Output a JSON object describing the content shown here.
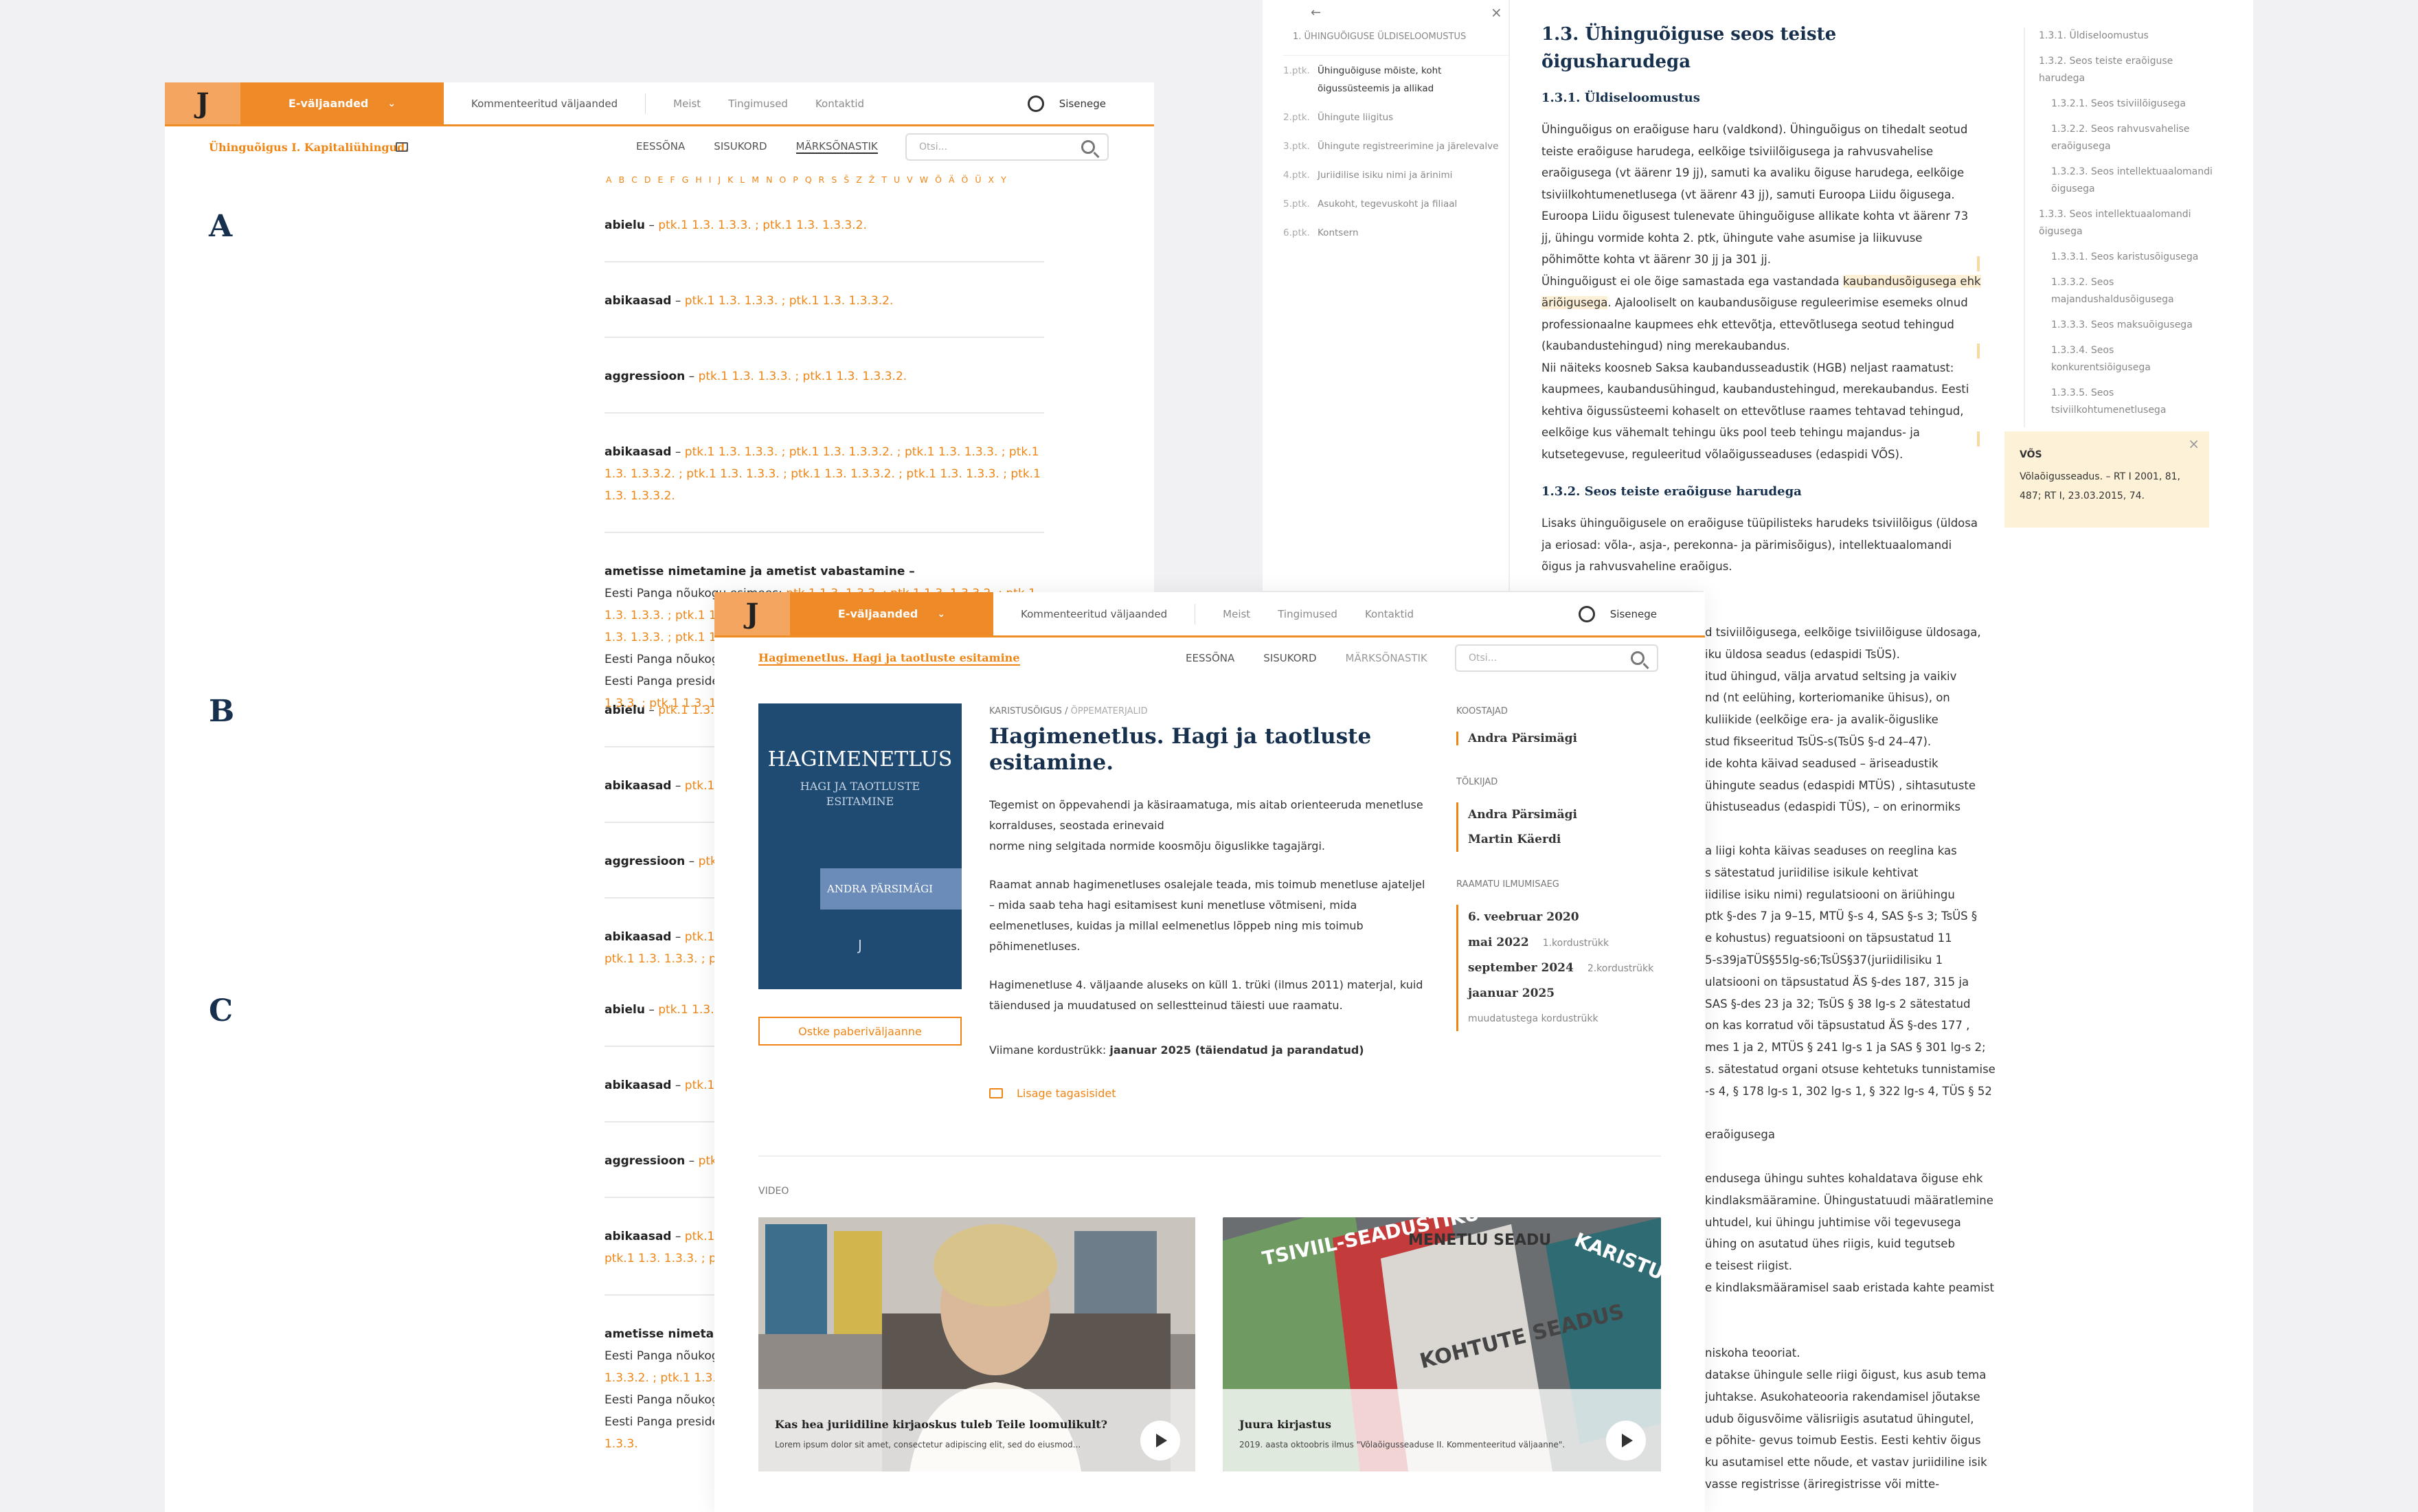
{
  "common": {
    "e_valjaanded": "E-väljaanded",
    "kommenteeritud": "Kommenteeritud väljaanded",
    "meist": "Meist",
    "tingimused": "Tingimused",
    "kontaktid": "Kontaktid",
    "sisenege": "Sisenege",
    "eessona": "EESSÕNA",
    "sisukord": "SISUKORD",
    "marksonastik": "MÄRKSÕNASTIK",
    "search_placeholder": "Otsi...",
    "logo": "J"
  },
  "index_page": {
    "book_title": "Ühinguõigus I. Kapitaliühingud.",
    "alphabet": [
      "A",
      "B",
      "C",
      "D",
      "E",
      "F",
      "G",
      "H",
      "I",
      "J",
      "K",
      "L",
      "M",
      "N",
      "O",
      "P",
      "Q",
      "R",
      "S",
      "Š",
      "Z",
      "Ž",
      "T",
      "U",
      "V",
      "W",
      "Õ",
      "Ä",
      "Ö",
      "Ü",
      "X",
      "Y"
    ],
    "sections": [
      {
        "letter": "A",
        "entries": [
          {
            "term": "abielu",
            "refs": "ptk.1 1.3. 1.3.3. ; ptk.1 1.3. 1.3.3.2."
          },
          {
            "term": "abikaasad",
            "refs": "ptk.1 1.3. 1.3.3. ; ptk.1 1.3. 1.3.3.2."
          },
          {
            "term": "aggressioon",
            "refs": "ptk.1 1.3. 1.3.3. ; ptk.1 1.3. 1.3.3.2."
          },
          {
            "term": "abikaasad",
            "refs": "ptk.1 1.3. 1.3.3. ; ptk.1 1.3. 1.3.3.2. ; ptk.1 1.3. 1.3.3. ; ptk.1 1.3. 1.3.3.2. ; ptk.1 1.3. 1.3.3. ; ptk.1 1.3. 1.3.3.2. ; ptk.1 1.3. 1.3.3. ; ptk.1 1.3. 1.3.3.2."
          },
          {
            "term": "ametisse nimetamine ja ametist vabastamine –",
            "sub": [
              {
                "label": "Eesti Panga nõukogu esimees:",
                "refs": "ptk.1 1.3. 1.3.3. ; ptk.1 1.3. 1.3.3.2. ; ptk.1 1.3. 1.3.3. ; ptk.1 1.3. 1.3.3.2. ; ptk.1 1.3. 1.3.3. ; ptk.1 1.3. 1.3.3.2. ; ptk.1 1.3. 1.3.3. ; ptk.1 1.3. 1.3.3.2."
              },
              {
                "label": "Eesti Panga nõukogu liikmed:",
                "refs": "ptk.1 1.3. 1.3.3."
              },
              {
                "label": "Eesti Panga president:",
                "refs": "ptk.1 1.3. 1.3.3. ; ptk.1 1.3. 1.3.3.2. ; ptk.1 1.3. 1.3.3. ; ptk.1 1.3. 1.3.3.2. ; ptk.1 1.3. 1.3.3."
              }
            ]
          }
        ]
      },
      {
        "letter": "B",
        "entries": [
          {
            "term": "abielu",
            "refs": "ptk.1 1.3. 1.3.3. ; ptk.1 1.3. 1.3.3.2."
          },
          {
            "term": "abikaasad",
            "refs": "ptk.1 1.3. 1.3.3. ; ptk.1 1.3. 1.3.3.2."
          },
          {
            "term": "aggressioon",
            "refs": "ptk.1 1.3. 1.3.3. ; ptk.1 1.3. 1.3.3.2."
          },
          {
            "term": "abikaasad",
            "refs": "ptk.1 1.3. 1.3.3. ; ptk.1 1.3. 1.3.3.2. ; ptk.1 1.3. 1.3.3.2. ; ptk.1 1.3. 1.3.3. ; ptk.1 1.3. 1.3.3.2. ; ptk"
          }
        ]
      },
      {
        "letter": "C",
        "entries": [
          {
            "term": "abielu",
            "refs": "ptk.1 1.3. 1.3.3. ; ptk.1 1.3. 1.3.3.2."
          },
          {
            "term": "abikaasad",
            "refs": "ptk.1 1.3. 1.3.3. ; ptk.1 1.3. 1.3.3.2."
          },
          {
            "term": "aggressioon",
            "refs": "ptk.1 1.3. 1.3.3. ; ptk.1 1.3. 1.3.3.2."
          },
          {
            "term": "abikaasad",
            "refs": "ptk.1 1.3. 1.3.3. ; ptk.1 1.3. 1.3.3.2. ; ptk.1 1.3. 1.3.3.2. ; ptk.1 1.3. 1.3.3. ; ptk.1 1.3. 1.3.3.2. ; ptk"
          },
          {
            "term": "ametisse nimetamine ja ametist vabastamine –",
            "sub": [
              {
                "label": "Eesti Panga nõukogu esimees:",
                "refs": "ptk.1 1.3. 1.3.3. ; ptk 1.3.3. ; ptk.1 1.3. 1.3.3.2. ; ptk.1 1.3. 1.3.3. ; ptk ptk.1 1.3.3.2."
              },
              {
                "label": "Eesti Panga nõukogu liikmed:",
                "refs": "ptk.1 1.3. 1.3.3."
              },
              {
                "label": "Eesti Panga president:",
                "refs": "ptk.1 1.3. 1.3.3. ; ptk.1 1.3. 1.3.3.2. ; ptk.1 1.3. 1.3.3."
              }
            ]
          }
        ]
      }
    ]
  },
  "reader_page": {
    "chapter_title": "1. ÜHINGUÕIGUSE ÜLDISELOOMUSTUS",
    "chapters": [
      {
        "num": "1.ptk.",
        "title": "Ühinguõiguse mõiste, koht õigussüsteemis ja allikad"
      },
      {
        "num": "2.ptk.",
        "title": "Ühingute liigitus"
      },
      {
        "num": "3.ptk.",
        "title": "Ühingute registreerimine ja järelevalve"
      },
      {
        "num": "4.ptk.",
        "title": "Juriidilise isiku nimi ja ärinimi"
      },
      {
        "num": "5.ptk.",
        "title": "Asukoht, tegevuskoht ja filiaal"
      },
      {
        "num": "6.ptk.",
        "title": "Kontsern"
      }
    ],
    "heading": "1.3. Ühinguõiguse seos teiste õigusharudega",
    "sub1": "1.3.1. Üldiseloomustus",
    "p1": "Ühinguõigus on eraõiguse haru (valdkond). Ühinguõigus on tihedalt seotud teiste eraõiguse harudega, eelkõige tsiviilõigusega ja rahvusvahelise eraõigusega (vt äärenr 19 jj), samuti ka avaliku õiguse harudega, eelkõige tsiviilkohtumenetlusega (vt äärenr 43 jj), samuti Euroopa Liidu õigusega. Euroopa Liidu õigusest tulenevate ühinguõiguse allikate kohta vt äärenr 73 jj, ühingu vormide kohta 2. ptk, ühingute vahe asumise ja liikuvuse põhimõtte kohta vt äärenr 30 jj ja 301 jj.",
    "p2a": "Ühinguõigust ei ole õige samastada ega vastandada ",
    "p2hl": "kaubandusõigusega ehk äriõigusega",
    "p2b": ". Ajalooliselt on kaubandusõiguse reguleerimise esemeks olnud professionaalne kaupmees ehk ettevõtja, ettevõtlusega seotud tehingud (kaubandustehingud) ning merekaubandus.",
    "p3": "Nii näiteks koosneb Saksa kaubandusseadustik (HGB) neljast raamatust: kaupmees, kaubandusühingud, kaubandustehingud, merekaubandus. Eesti kehtiva õigussüsteemi kohaselt on ettevõtluse raames tehtavad tehingud, eelkõige kus vähemalt tehingu üks pool teeb tehingu majandus- ja kutsetegevuse, reguleeritud võlaõigusseaduses (edaspidi VÕS).",
    "sub2": "1.3.2. Seos teiste eraõiguse harudega",
    "p4": "Lisaks ühinguõigusele on eraõiguse tüüpilisteks harudeks tsiviilõigus (üldosa ja eriosad: võla-, asja-, perekonna- ja pärimisõigus), intellektuaalomandi õigus ja rahvusvaheline eraõigus.",
    "cont": [
      "d tsiviilõigusega, eelkõige tsiviilõiguse üldosaga,",
      "iku üldosa seadus (edaspidi TsÜS).",
      "itud ühingud, välja arvatud seltsing ja vaikiv",
      "nd (nt eelühing, korteriomanike ühisus), on",
      "kuliikide (eelkõige era- ja avalik-õiguslike",
      "stud fikseeritud TsÜS-s(TsÜS §-d 24–47).",
      "ide kohta käivad seadused – äriseadustik",
      "ühingute seadus (edaspidi MTÜS) , sihtasutuste",
      "ühistuseadus (edaspidi TÜS), – on erinormiks",
      "",
      "a liigi kohta käivas seaduses on reeglina kas",
      "s sätestatud juriidilise isikule kehtivat",
      "iidilise isiku nimi) regulatsiooni on äriühingu",
      "ptk §-des 7 ja 9–15, MTÜ §-s 4, SAS §-s 3; TsÜS §",
      "e kohustus) reguatsiooni on täpsustatud 11",
      "5-s39jaTÜS§55lg-s6;TsÜS§37(juriidilisiku 1",
      "ulatsiooni on täpsustatud ÄS §-des 187, 315 ja",
      "SAS §-des 23 ja 32; TsÜS § 38 lg-s 2 sätestatud",
      "on kas korratud või täpsustatud ÄS §-des 177 ,",
      "mes 1 ja 2, MTÜS § 241 lg-s 1 ja SAS § 301 lg-s 2;",
      "s. sätestatud organi otsuse kehtetuks tunnistamise",
      "-s 4, § 178 lg-s 1, 302 lg-s 1, § 322 lg-s 4, TÜS § 52",
      "",
      "eraõigusega",
      "",
      "endusega ühingu suhtes kohaldatava õiguse ehk",
      "kindlaksmääramine. Ühingustatuudi määratlemine",
      "uhtudel, kui ühingu juhtimise või tegevusega",
      "ühing on asutatud ühes riigis, kuid tegutseb",
      "e teisest riigist.",
      "e kindlaksmääramisel saab eristada kahte peamist",
      "",
      "",
      "niskoha teooriat.",
      "datakse ühingule selle riigi õigust, kus asub tema",
      "juhtakse. Asukohateooria rakendamisel jõutakse",
      "udub õigusvõime välisriigis asutatud ühingutel,",
      "e põhite- gevus toimub Eestis. Eesti kehtiv õigus",
      "ku asutamisel ette nõude, et vastav juriidiline isik",
      "vasse registrisse (äriregistrisse või mitte-"
    ],
    "right_toc": [
      "1.3.1. Üldiseloomustus",
      "1.3.2. Seos teiste eraõiguse harudega",
      "1.3.2.1. Seos tsiviilõigusega",
      "1.3.2.2. Seos rahvusvahelise eraõigusega",
      "1.3.2.3. Seos intellektuaalomandi õigusega",
      "1.3.3. Seos intellektuaalomandi õigusega",
      "1.3.3.1. Seos karistusõigusega",
      "1.3.3.2. Seos majandushaldusõigusega",
      "1.3.3.3. Seos maksuõigusega",
      "1.3.3.4. Seos konkurentsiõigusega",
      "1.3.3.5. Seos tsiviilkohtumenetlusega"
    ],
    "note_title": "VÕS",
    "note_text": "Võlaõigusseadus. – RT I 2001, 81, 487; RT I, 23.03.2015, 74."
  },
  "book_page": {
    "subbar_title": "Hagimenetlus. Hagi ja taotluste esitamine",
    "cover_title": "HAGIMENETLUS",
    "cover_subtitle": "HAGI JA TAOTLUSTE ESITAMINE",
    "cover_author": "ANDRA PÄRSIMÄGI",
    "buy_button": "Ostke paberiväljaanne",
    "crumb_a": "KARISTUSÕIGUS",
    "crumb_sep": " / ",
    "crumb_b": "ÕPPEMATERJALID",
    "title": "Hagimenetlus. Hagi ja taotluste esitamine.",
    "desc1": "Tegemist on õppevahendi ja käsiraamatuga, mis aitab orienteeruda menetluse korralduses, seostada erinevaid",
    "desc1b": "norme ning selgitada normide koosmõju õiguslikke tagajärgi.",
    "desc2": "Raamat annab hagimenetluses osalejale teada, mis toimub menetluse ajateljel – mida saab teha hagi esitamisest kuni menetluse võtmiseni, mida eelmenetluses, kuidas ja millal eelmenetlus lõppeb ning mis toimub põhimenetluses.",
    "desc3": "Hagimenetluse 4. väljaande aluseks on küll 1. trüki (ilmus 2011) materjal, kuid täiendused ja muudatused on sellestteinud täiesti uue raamatu.",
    "last_label": "Viimane kordustrükk: ",
    "last_value": "jaanuar 2025 (täiendatud ja parandatud)",
    "feedback": "Lisage tagasisidet",
    "koostajad_label": "KOOSTAJAD",
    "koostaja": "Andra Pärsimägi",
    "toimetajad_label": "TÕLKIJAD",
    "toimetajad": [
      "Andra Pärsimägi",
      "Martin Käerdi"
    ],
    "dates_label": "RAAMATU ILMUMISAEG",
    "dates": [
      {
        "d": "6. veebruar 2020",
        "n": ""
      },
      {
        "d": "mai 2022",
        "n": "1.kordustrükk"
      },
      {
        "d": "september 2024",
        "n": "2.kordustrükk"
      },
      {
        "d": "jaanuar 2025",
        "n": "muudatustega kordustrükk"
      }
    ],
    "video_label": "VIDEO",
    "videos": [
      {
        "title": "Kas hea juriidiline kirjaoskus tuleb Teile loomulikult?",
        "text": "Lorem ipsum dolor sit amet, consectetur adipiscing elit, sed do eiusmod..."
      },
      {
        "title": "Juura kirjastus",
        "text": "2019. aasta oktoobris ilmus \"Võlaõigusseaduse II. Kommenteeritud väljaanne\"."
      }
    ],
    "book_spines": [
      "TSIVIIL-SEADUSTIKU ÜLDOSA SEADUS",
      "KOHTUTE SEADUS",
      "KARISTUSEA",
      "MENETLU SEADU"
    ]
  },
  "colors": {
    "orange": "#ef8515",
    "navy": "#17304d",
    "cover": "#1f4a72"
  }
}
